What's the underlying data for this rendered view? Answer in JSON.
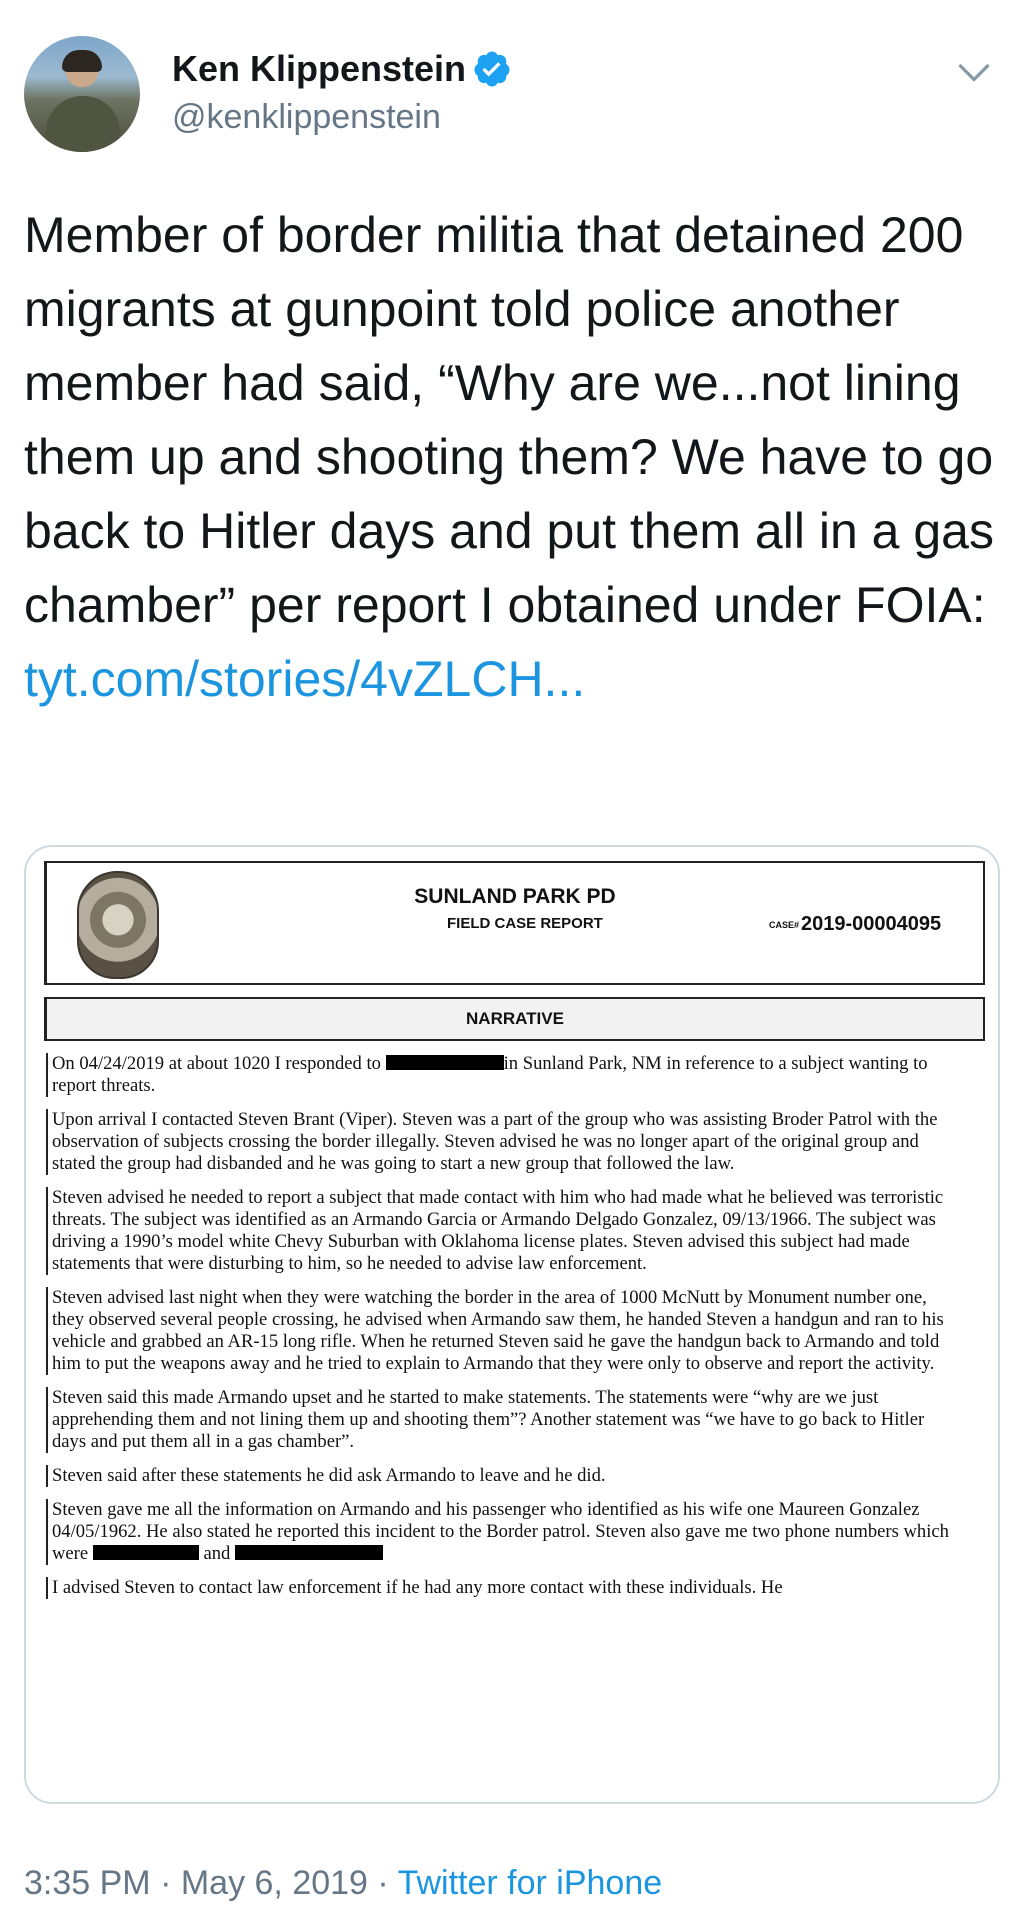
{
  "author": {
    "name": "Ken Klippenstein",
    "handle": "@kenklippenstein",
    "avatar_icon": "profile-photo",
    "verified_icon": "verified-badge-icon"
  },
  "tweet": {
    "text": "Member of border militia that detained 200 migrants at gunpoint told police another member had said, “Why are we...not lining them up and shooting them? We have to go back to Hitler days and put them all in a gas chamber” per report I obtained under FOIA: ",
    "link": "tyt.com/stories/4vZLCH..."
  },
  "report": {
    "agency": "SUNLAND PARK PD",
    "type": "FIELD CASE REPORT",
    "case_label": "CASE#",
    "case_number": "2019-00004095",
    "section": "NARRATIVE",
    "p1_a": "On 04/24/2019 at about 1020 I responded to",
    "p1_b": "in Sunland Park, NM in reference to a subject wanting to report threats.",
    "p2": "Upon arrival I contacted Steven Brant (Viper). Steven was a part of the group who was assisting Broder Patrol with the observation of subjects crossing the border illegally. Steven advised he was no longer apart of the original group and stated the group had disbanded and he was going to start a new group that followed the law.",
    "p3": "Steven advised he needed to report a subject that made contact with him who had made what he believed was terroristic threats. The subject was identified as an Armando Garcia or Armando Delgado Gonzalez, 09/13/1966. The subject was driving a 1990’s model white Chevy Suburban with Oklahoma license plates. Steven advised this subject had made statements that were disturbing to him, so he needed to advise law enforcement.",
    "p4": "Steven advised last night when they were watching the border in the area of 1000 McNutt by Monument number one, they observed several people crossing, he advised when Armando saw them, he handed Steven a handgun and ran to his vehicle and grabbed an AR-15 long rifle. When he returned Steven said he gave the handgun back to Armando and told him to put the weapons away and he tried to explain to Armando that they were only to observe and report the activity.",
    "p5": "Steven said this made Armando upset and he started to make statements. The statements were “why are we just apprehending them and not lining them up and shooting them”? Another statement was “we have to go back to Hitler days and put them all in a gas chamber”.",
    "p6": "Steven said after these statements he did ask Armando to leave and he did.",
    "p7_a": "Steven gave me all the information on Armando and his passenger who identified as his wife one Maureen Gonzalez 04/05/1962. He also stated he reported this incident to the Border patrol. Steven also gave me two phone numbers which were",
    "p7_and": "and",
    "p8": "I advised Steven to contact law enforcement if he had any more contact with these individuals. He"
  },
  "footer": {
    "time": "3:35 PM",
    "sep1": " · ",
    "date": "May 6, 2019",
    "sep2": " · ",
    "source": "Twitter for iPhone"
  },
  "colors": {
    "link": "#1b95e0",
    "verified": "#1da1f2",
    "meta": "#657786"
  }
}
